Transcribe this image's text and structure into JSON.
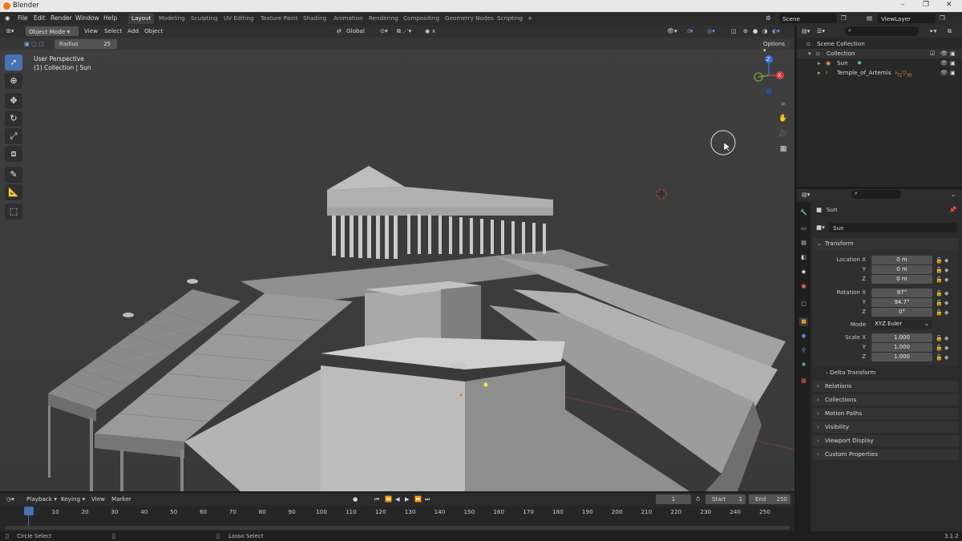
{
  "window": {
    "title": "Blender",
    "controls": {
      "minimize": "–",
      "maximize": "❐",
      "close": "✕"
    }
  },
  "menu": [
    "File",
    "Edit",
    "Render",
    "Window",
    "Help"
  ],
  "workspaces": [
    "Layout",
    "Modeling",
    "Sculpting",
    "UV Editing",
    "Texture Paint",
    "Shading",
    "Animation",
    "Rendering",
    "Compositing",
    "Geometry Nodes",
    "Scripting"
  ],
  "active_workspace": "Layout",
  "scene": {
    "name": "Scene",
    "view_layer": "ViewLayer"
  },
  "viewport": {
    "mode": "Object Mode",
    "header_menus": [
      "View",
      "Select",
      "Add",
      "Object"
    ],
    "orientation": "Global",
    "tool_setting_label": "Radius",
    "tool_setting_value": "25",
    "options_label": "Options",
    "view_name": "User Perspective",
    "context": "(1) Collection | Sun",
    "gizmo": {
      "z": "Z",
      "y": "Y",
      "x": "X"
    }
  },
  "outliner": {
    "scene_collection": "Scene Collection",
    "collection": "Collection",
    "items": [
      {
        "name": "Sun"
      },
      {
        "name": "Temple_of_Artemis",
        "badge1": "72",
        "badge2": "39"
      }
    ]
  },
  "properties": {
    "object_name": "Sun",
    "data_name": "Sun",
    "transform_title": "Transform",
    "location": {
      "label": "Location X",
      "x": "0 m",
      "y": "0 m",
      "z": "0 m"
    },
    "rotation": {
      "label": "Rotation X",
      "x": "87°",
      "y": "94.7°",
      "z": "0°"
    },
    "mode_label": "Mode",
    "mode_value": "XYZ Euler",
    "scale": {
      "label": "Scale X",
      "x": "1.000",
      "y": "1.000",
      "z": "1.000"
    },
    "axis_y": "Y",
    "axis_z": "Z",
    "delta_transform": "Delta Transform",
    "panels": [
      "Relations",
      "Collections",
      "Motion Paths",
      "Visibility",
      "Viewport Display",
      "Custom Properties"
    ]
  },
  "timeline": {
    "menus": [
      "Playback",
      "Keying",
      "View",
      "Marker"
    ],
    "current_frame": "1",
    "start_label": "Start",
    "start_value": "1",
    "end_label": "End",
    "end_value": "250",
    "ticks": [
      "1",
      "10",
      "20",
      "30",
      "40",
      "50",
      "60",
      "70",
      "80",
      "90",
      "100",
      "110",
      "120",
      "130",
      "140",
      "150",
      "160",
      "170",
      "180",
      "190",
      "200",
      "210",
      "220",
      "230",
      "240",
      "250"
    ]
  },
  "status": {
    "left": "Circle Select",
    "middle": "Lasso Select",
    "version": "3.1.2"
  },
  "colors": {
    "accent": "#4772b3",
    "selection": "#e87d0d",
    "viewport_bg": "#3d3d3d"
  }
}
